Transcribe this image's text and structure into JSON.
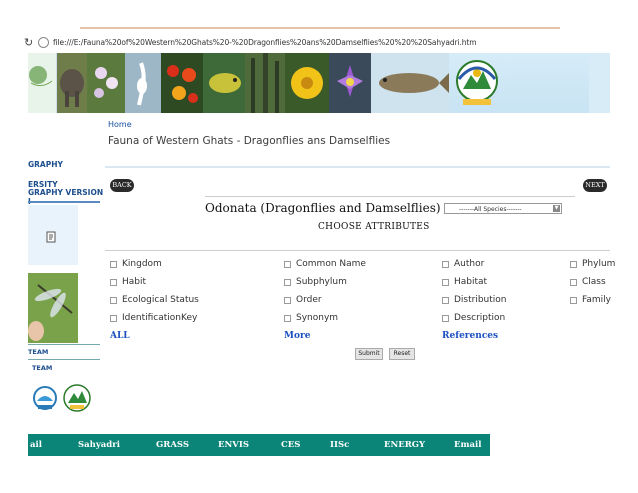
{
  "browser": {
    "url": "file:///E:/Fauna%20of%20Western%20Ghats%20-%20Dragonflies%20ans%20Damselflies%20%20%20Sahyadri.htm"
  },
  "sidebar": {
    "items": [
      "GRAPHY",
      "ERSITY",
      "GRAPHY VERSION I"
    ],
    "team1": "TEAM",
    "team2": "TEAM"
  },
  "header": {
    "breadcrumb": "Home",
    "title": "Fauna of Western Ghats - Dragonflies ans Damselflies"
  },
  "nav": {
    "back": "BACK",
    "next": "NEXT"
  },
  "database": {
    "title": "Odonata (Dragonflies and Damselflies) Database",
    "select_value": "-------All Species-------",
    "choose": "CHOOSE ATTRIBUTES"
  },
  "attributes": {
    "col1": [
      "Kingdom",
      "Habit",
      "Ecological Status",
      "IdentificationKey"
    ],
    "col2": [
      "Common Name",
      "Subphylum",
      "Order",
      "Synonym"
    ],
    "col3": [
      "Author",
      "Habitat",
      "Distribution",
      "Description"
    ],
    "col4": [
      "Phylum",
      "Class",
      "Family"
    ]
  },
  "links": {
    "all": "ALL",
    "more": "More",
    "references": "References"
  },
  "buttons": {
    "submit": "Submit",
    "reset": "Reset"
  },
  "footer": {
    "items": [
      "ail",
      "Sahyadri",
      "GRASS",
      "ENVIS",
      "CES",
      "IISc",
      "ENERGY",
      "Email"
    ]
  },
  "colors": {
    "footer_bg": "#0b8577",
    "link": "#1a50c0",
    "banner_bg": "#d7ecf6"
  }
}
